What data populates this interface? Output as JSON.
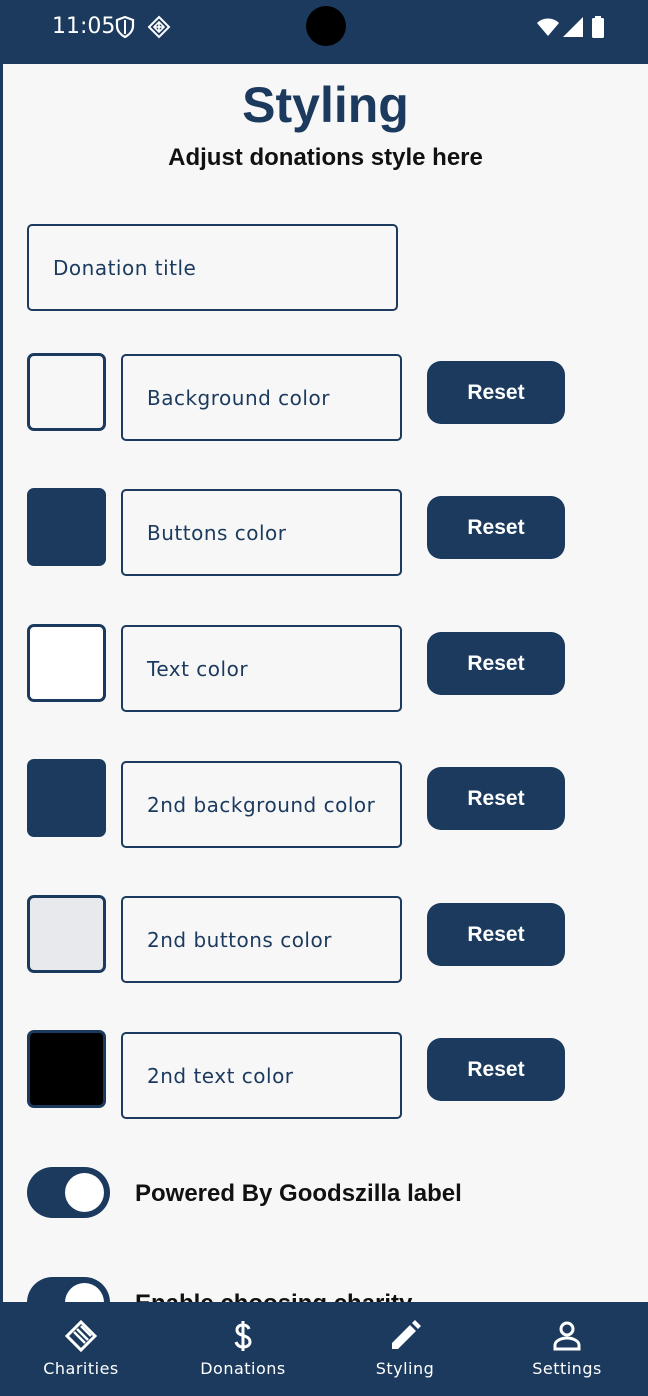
{
  "status_bar": {
    "time": "11:05",
    "icons": [
      "shield-icon",
      "diamond-grid-icon",
      "wifi-icon",
      "signal-icon",
      "battery-icon"
    ]
  },
  "header": {
    "title": "Styling",
    "subtitle": "Adjust donations style here"
  },
  "donation_title_field": {
    "placeholder": "Donation title"
  },
  "color_rows": [
    {
      "label": "Background color",
      "swatch": "#f7f7f7",
      "reset_label": "Reset"
    },
    {
      "label": "Buttons color",
      "swatch": "#1b3a5e",
      "reset_label": "Reset"
    },
    {
      "label": "Text color",
      "swatch": "#ffffff",
      "reset_label": "Reset"
    },
    {
      "label": "2nd background color",
      "swatch": "#1b3a5e",
      "reset_label": "Reset"
    },
    {
      "label": "2nd buttons color",
      "swatch": "#e8e9ec",
      "reset_label": "Reset"
    },
    {
      "label": "2nd text color",
      "swatch": "#000000",
      "reset_label": "Reset"
    }
  ],
  "toggles": [
    {
      "label": "Powered By Goodszilla label",
      "on": true
    },
    {
      "label": "Enable choosing charity",
      "on": true
    }
  ],
  "bottom_nav": [
    {
      "label": "Charities",
      "icon": "charities-icon"
    },
    {
      "label": "Donations",
      "icon": "dollar-icon"
    },
    {
      "label": "Styling",
      "icon": "pencil-icon"
    },
    {
      "label": "Settings",
      "icon": "person-icon"
    }
  ],
  "colors": {
    "primary": "#1b3a5e",
    "background": "#f7f7f7"
  }
}
